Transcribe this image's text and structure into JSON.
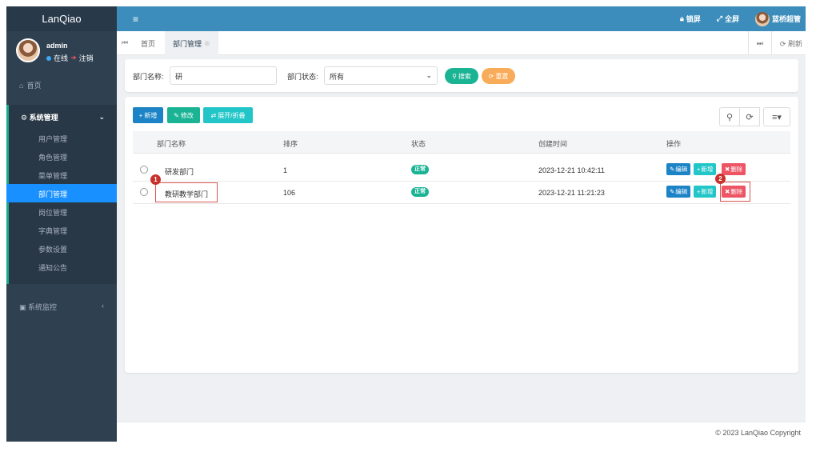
{
  "app": {
    "logo": "LanQiao"
  },
  "user": {
    "name": "admin",
    "status": "在线",
    "logout": "注销"
  },
  "sidebar": {
    "home": "首页",
    "groups": [
      {
        "label": "系统管理",
        "items": [
          "用户管理",
          "角色管理",
          "菜单管理",
          "部门管理",
          "岗位管理",
          "字典管理",
          "参数设置",
          "通知公告"
        ],
        "active": "部门管理"
      },
      {
        "label": "系统监控"
      }
    ]
  },
  "header": {
    "lock": "锁屏",
    "fullscreen": "全屏",
    "username": "蓝桥超管"
  },
  "tabs": {
    "items": [
      "首页",
      "部门管理"
    ],
    "active": "部门管理",
    "refresh": "刷新"
  },
  "search": {
    "dept_name_label": "部门名称:",
    "dept_name_value": "研",
    "status_label": "部门状态:",
    "status_value": "所有",
    "search_btn": "搜索",
    "reset_btn": "重置"
  },
  "toolbar": {
    "add": "新增",
    "edit": "修改",
    "expand": "展开/折叠"
  },
  "table": {
    "headers": [
      "部门名称",
      "排序",
      "状态",
      "创建时间",
      "操作"
    ],
    "rows": [
      {
        "name": "研发部门",
        "order": "1",
        "status": "正常",
        "created": "2023-12-21 10:42:11"
      },
      {
        "name": "教研教学部门",
        "order": "106",
        "status": "正常",
        "created": "2023-12-21 11:21:23"
      }
    ],
    "actions": {
      "edit": "编辑",
      "add": "新增",
      "delete": "删除"
    }
  },
  "annotations": {
    "marker1": "1",
    "marker2": "2"
  },
  "footer": {
    "copyright": "© 2023 LanQiao Copyright"
  },
  "colors": {
    "sidebar_bg": "#2f4050",
    "header_bg": "#3c8dbc",
    "active_nav": "#1890ff",
    "primary": "#1c84c6",
    "success": "#1ab394",
    "info": "#23c6c8",
    "danger": "#ed5565",
    "warning": "#f8ac59"
  }
}
